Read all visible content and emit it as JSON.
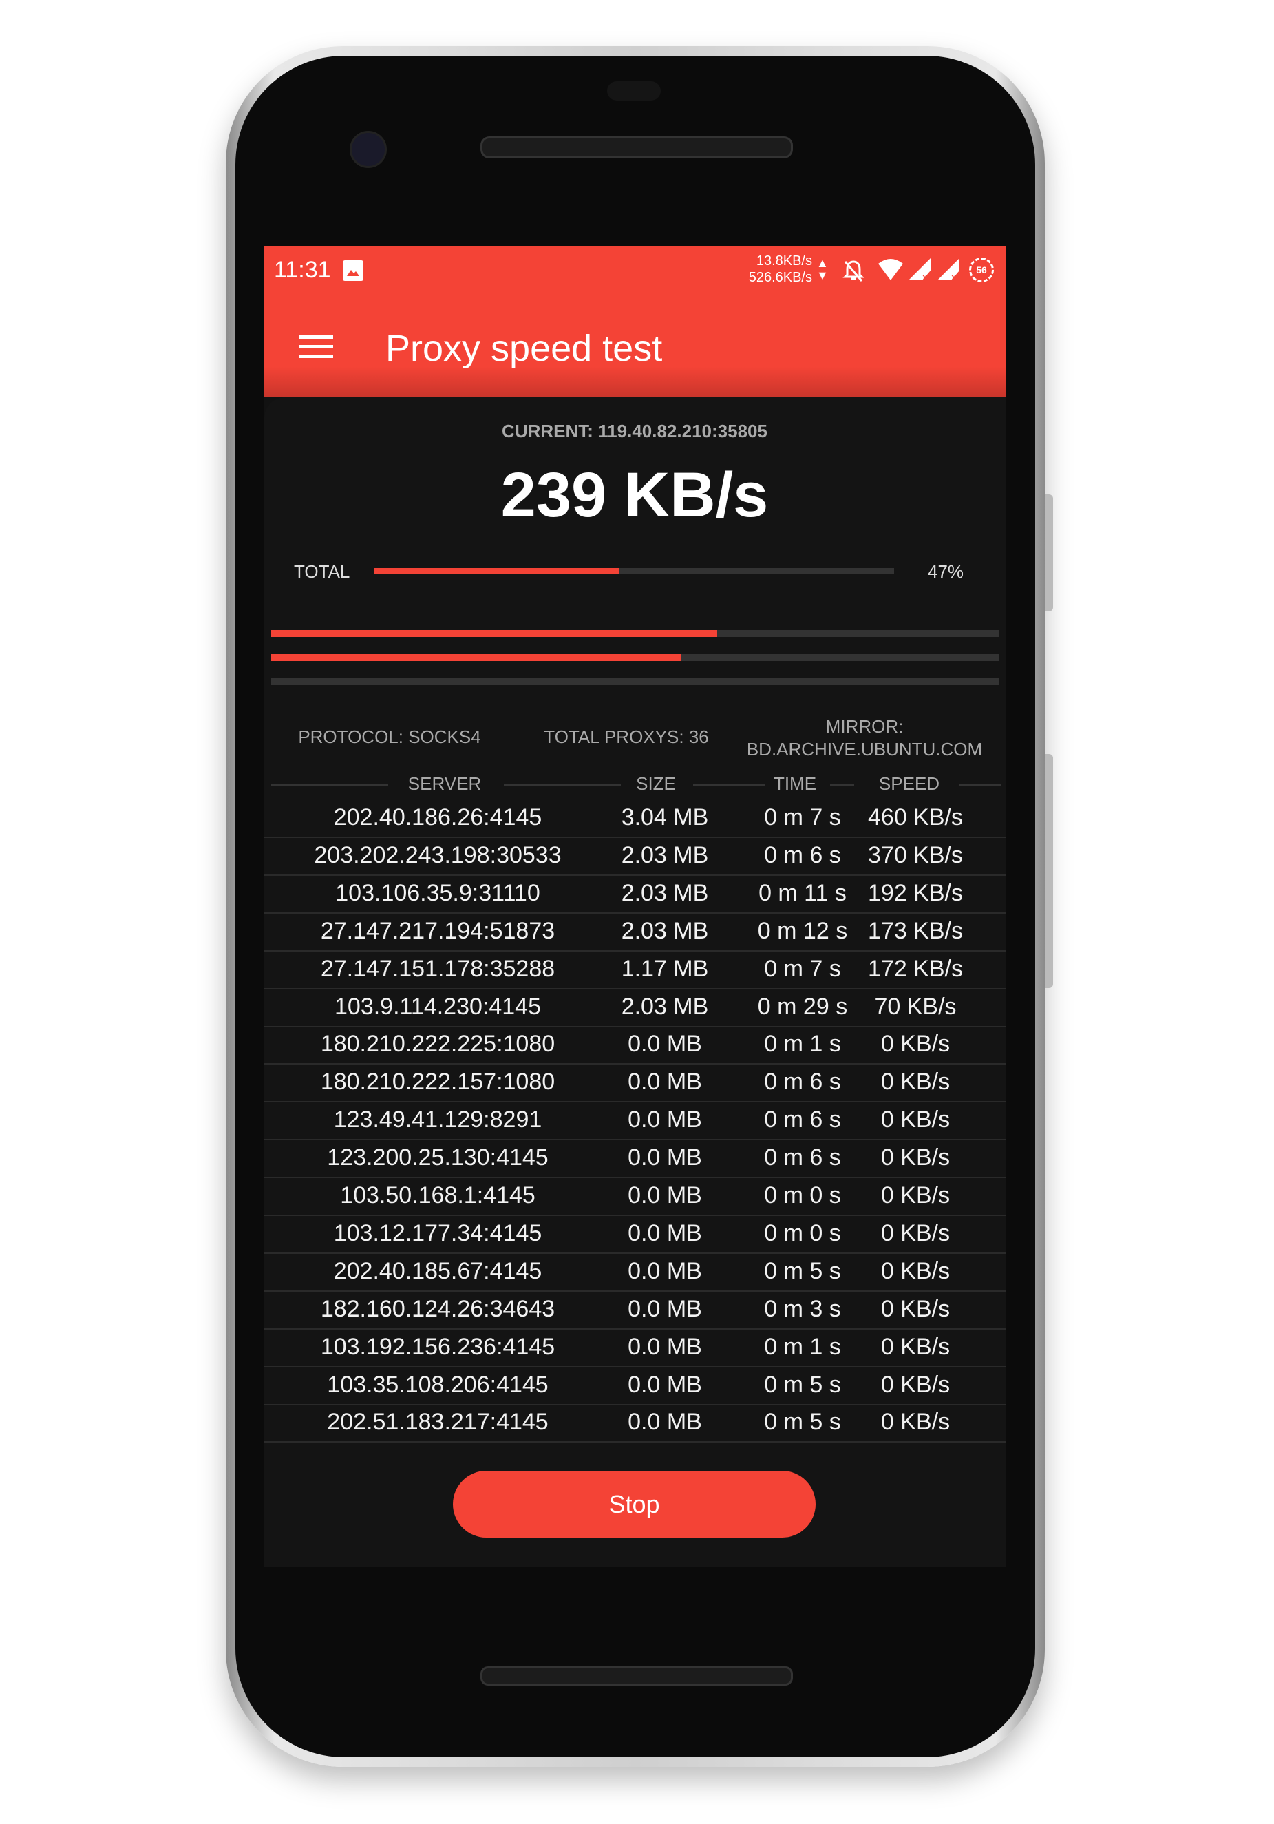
{
  "status_bar": {
    "time": "11:31",
    "net_up": "13.8KB/s",
    "net_down": "526.6KB/s",
    "battery": "56"
  },
  "app_bar": {
    "title": "Proxy speed test"
  },
  "current": {
    "label": "CURRENT: 119.40.82.210:35805",
    "speed": "239 KB/s"
  },
  "total": {
    "label": "TOTAL",
    "percent_text": "47%",
    "progress": 0.47
  },
  "threads": [
    0.613,
    0.564,
    0.0
  ],
  "info": {
    "protocol": "PROTOCOL: SOCKS4",
    "total_proxys": "TOTAL PROXYS: 36",
    "mirror_label": "MIRROR:",
    "mirror_value": "BD.ARCHIVE.UBUNTU.COM"
  },
  "table": {
    "headers": [
      "SERVER",
      "SIZE",
      "TIME",
      "SPEED"
    ],
    "rows": [
      [
        "202.40.186.26:4145",
        "3.04 MB",
        "0 m 7 s",
        "460 KB/s"
      ],
      [
        "203.202.243.198:30533",
        "2.03 MB",
        "0 m 6 s",
        "370 KB/s"
      ],
      [
        "103.106.35.9:31110",
        "2.03 MB",
        "0 m 11 s",
        "192 KB/s"
      ],
      [
        "27.147.217.194:51873",
        "2.03 MB",
        "0 m 12 s",
        "173 KB/s"
      ],
      [
        "27.147.151.178:35288",
        "1.17 MB",
        "0 m 7 s",
        "172 KB/s"
      ],
      [
        "103.9.114.230:4145",
        "2.03 MB",
        "0 m 29 s",
        "70 KB/s"
      ],
      [
        "180.210.222.225:1080",
        "0.0 MB",
        "0 m 1 s",
        "0 KB/s"
      ],
      [
        "180.210.222.157:1080",
        "0.0 MB",
        "0 m 6 s",
        "0 KB/s"
      ],
      [
        "123.49.41.129:8291",
        "0.0 MB",
        "0 m 6 s",
        "0 KB/s"
      ],
      [
        "123.200.25.130:4145",
        "0.0 MB",
        "0 m 6 s",
        "0 KB/s"
      ],
      [
        "103.50.168.1:4145",
        "0.0 MB",
        "0 m 0 s",
        "0 KB/s"
      ],
      [
        "103.12.177.34:4145",
        "0.0 MB",
        "0 m 0 s",
        "0 KB/s"
      ],
      [
        "202.40.185.67:4145",
        "0.0 MB",
        "0 m 5 s",
        "0 KB/s"
      ],
      [
        "182.160.124.26:34643",
        "0.0 MB",
        "0 m 3 s",
        "0 KB/s"
      ],
      [
        "103.192.156.236:4145",
        "0.0 MB",
        "0 m 1 s",
        "0 KB/s"
      ],
      [
        "103.35.108.206:4145",
        "0.0 MB",
        "0 m 5 s",
        "0 KB/s"
      ],
      [
        "202.51.183.217:4145",
        "0.0 MB",
        "0 m 5 s",
        "0 KB/s"
      ]
    ]
  },
  "stop_button": {
    "label": "Stop"
  },
  "colors": {
    "accent": "#f44336",
    "background": "#141414"
  }
}
